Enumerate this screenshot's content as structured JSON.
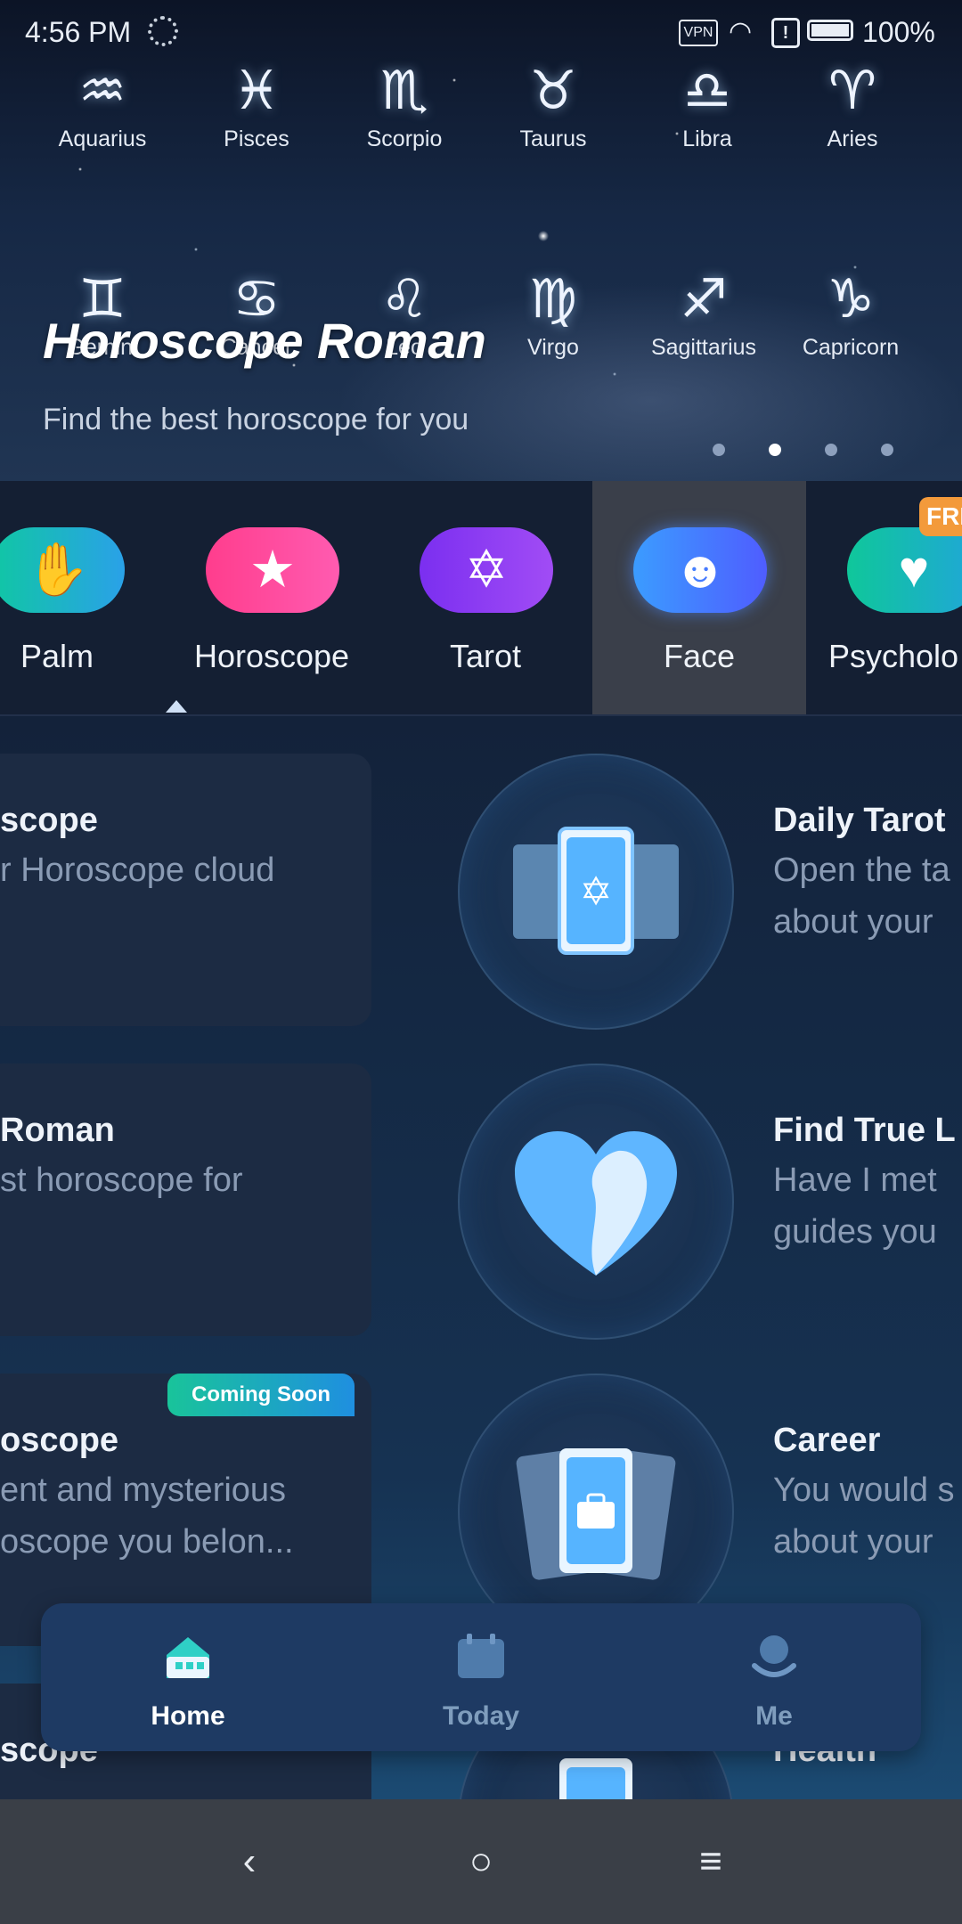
{
  "status": {
    "time": "4:56 PM",
    "vpn": "VPN",
    "battery": "100%"
  },
  "banner": {
    "title": "Horoscope Roman",
    "subtitle": "Find the best horoscope for you",
    "signs_row1": [
      {
        "name": "Aquarius",
        "glyph": "♒"
      },
      {
        "name": "Pisces",
        "glyph": "♓"
      },
      {
        "name": "Scorpio",
        "glyph": "♏"
      },
      {
        "name": "Taurus",
        "glyph": "♉"
      },
      {
        "name": "Libra",
        "glyph": "♎"
      },
      {
        "name": "Aries",
        "glyph": "♈"
      }
    ],
    "signs_row2": [
      {
        "name": "Gemini",
        "glyph": "♊"
      },
      {
        "name": "Cancer",
        "glyph": "♋"
      },
      {
        "name": "Leo",
        "glyph": "♌"
      },
      {
        "name": "Virgo",
        "glyph": "♍"
      },
      {
        "name": "Sagittarius",
        "glyph": "♐"
      },
      {
        "name": "Capricorn",
        "glyph": "♑"
      }
    ],
    "pager_active": 2
  },
  "categories": [
    {
      "label": "Palm",
      "icon": "hand-icon",
      "color": "#16c2b8"
    },
    {
      "label": "Horoscope",
      "icon": "star-icon",
      "color": "#ff3f97"
    },
    {
      "label": "Tarot",
      "icon": "tarot-card-icon",
      "color": "#8d3bf0"
    },
    {
      "label": "Face",
      "icon": "face-icon",
      "color": "#3c7bff"
    },
    {
      "label": "Psycholo",
      "icon": "heart-icon",
      "color": "#12c6a6"
    }
  ],
  "free_badge": "FRE",
  "left_cards": [
    {
      "title": "scope",
      "desc": [
        "r Horoscope cloud"
      ]
    },
    {
      "title": " Roman",
      "desc": [
        "st horoscope for"
      ]
    },
    {
      "title": "oscope",
      "desc": [
        "ent and mysterious",
        "oscope you belon..."
      ],
      "badge": "Coming Soon"
    },
    {
      "title": "scope",
      "desc": []
    }
  ],
  "right_cards": [
    {
      "title": "Daily Tarot",
      "desc": [
        "Open the ta",
        "about your "
      ]
    },
    {
      "title": "Find True L",
      "desc": [
        "Have I met ",
        "guides you "
      ]
    },
    {
      "title": "Career",
      "desc": [
        "You would s",
        "about your "
      ]
    },
    {
      "title": "Health",
      "desc": []
    }
  ],
  "tabs": [
    {
      "label": "Home",
      "active": true,
      "icon": "home-icon"
    },
    {
      "label": "Today",
      "active": false,
      "icon": "calendar-icon"
    },
    {
      "label": "Me",
      "active": false,
      "icon": "profile-icon"
    }
  ],
  "nav": {
    "back": "‹",
    "home": "○",
    "menu": "≡"
  }
}
